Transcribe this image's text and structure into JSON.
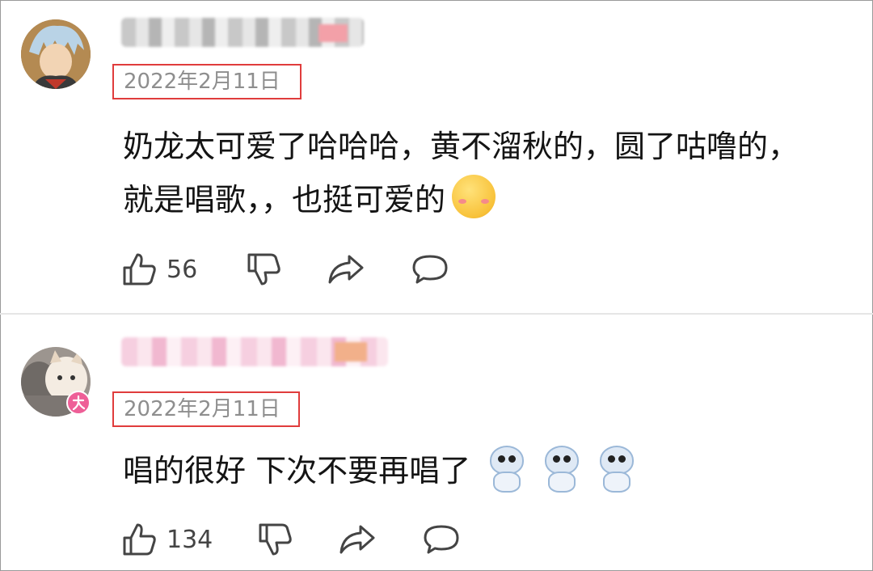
{
  "comments": [
    {
      "date": "2022年2月11日",
      "text_line1": "奶龙太可爱了哈哈哈，黄不溜秋的，圆了咕噜的，",
      "text_line2": "就是唱歌，，也挺可爱的",
      "emoji": "shy-face-emoji",
      "likes": "56",
      "icons": [
        "thumbs-up-icon",
        "thumbs-down-icon",
        "share-icon",
        "comment-icon"
      ]
    },
    {
      "date": "2022年2月11日",
      "text_line1": "唱的很好 下次不要再唱了",
      "emoji": "bing-dwen-dwen-emoji",
      "emoji_count": 3,
      "likes": "134",
      "icons": [
        "thumbs-up-icon",
        "thumbs-down-icon",
        "share-icon",
        "comment-icon"
      ]
    }
  ],
  "colors": {
    "date_box_border": "#e03c3c",
    "date_text": "#8e8e8e",
    "icon_stroke": "#444444"
  }
}
